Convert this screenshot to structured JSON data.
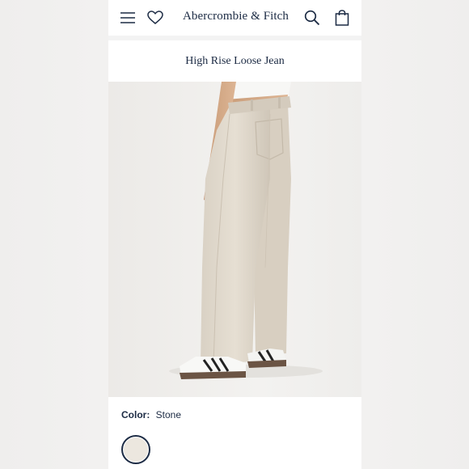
{
  "header": {
    "brand": "Abercrombie & Fitch",
    "icons": [
      "menu-icon",
      "heart-icon",
      "search-icon",
      "shopping-bag-icon"
    ]
  },
  "product": {
    "title": "High Rise Loose Jean",
    "color_label": "Color:",
    "color_value": "Stone",
    "swatch_color": "#ece7df"
  },
  "colors": {
    "brand_navy": "#1c2b44",
    "background": "#ffffff"
  }
}
